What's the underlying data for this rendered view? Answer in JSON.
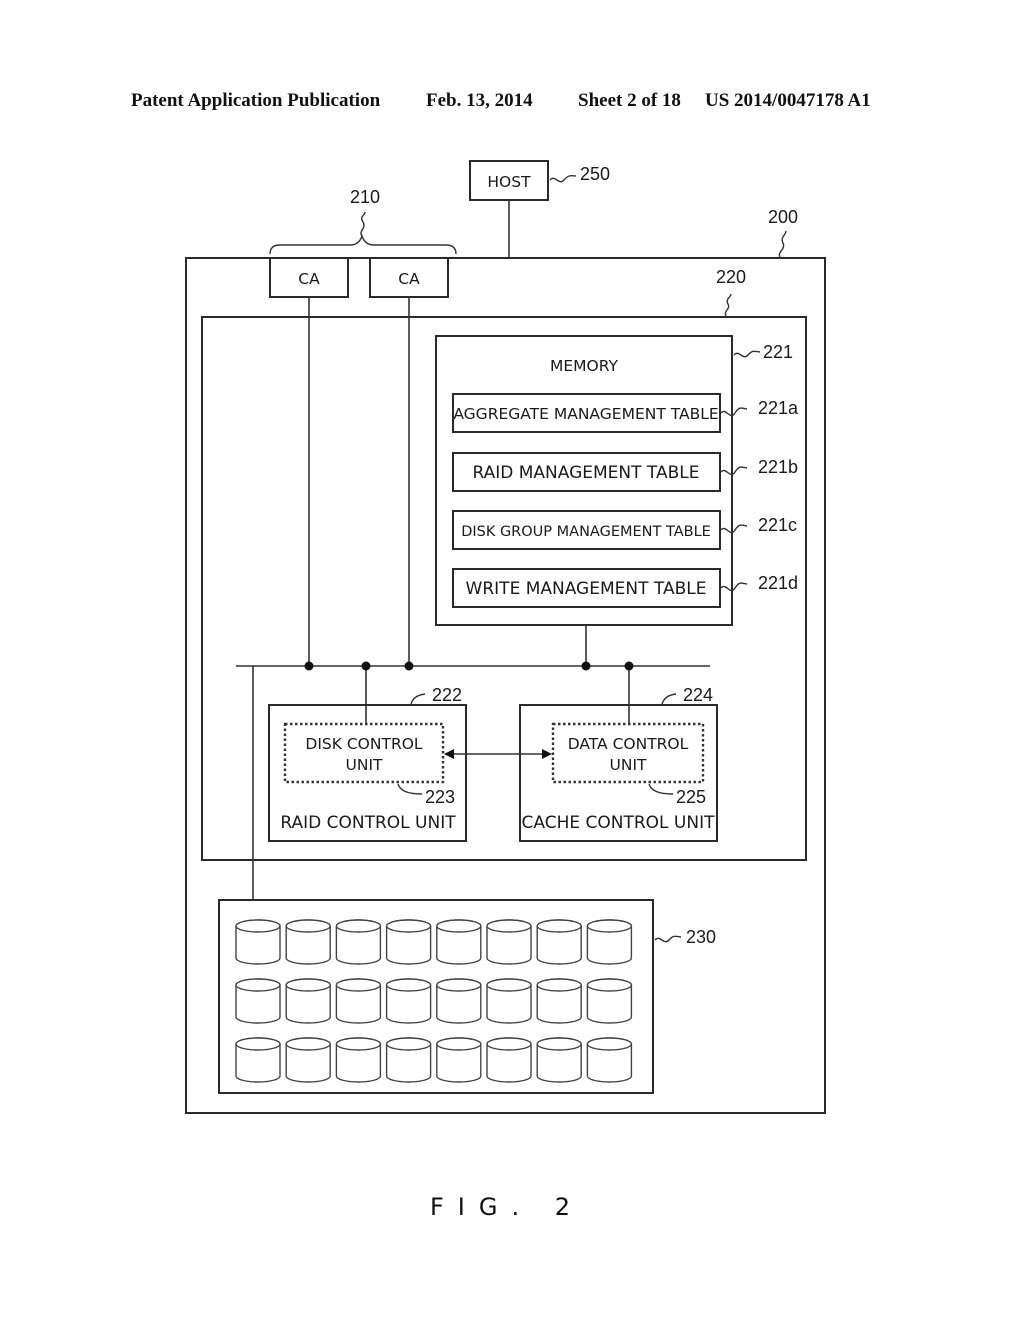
{
  "header": {
    "publication": "Patent Application Publication",
    "date": "Feb. 13, 2014",
    "sheet": "Sheet 2 of 18",
    "number": "US 2014/0047178 A1"
  },
  "diagram": {
    "host": {
      "label": "HOST",
      "ref": "250"
    },
    "storage_apparatus": {
      "ref": "200"
    },
    "channel_adapters": {
      "ref": "210",
      "items": [
        {
          "label": "CA"
        },
        {
          "label": "CA"
        }
      ]
    },
    "controller": {
      "ref": "220"
    },
    "memory": {
      "label": "MEMORY",
      "ref": "221",
      "tables": [
        {
          "label": "AGGREGATE MANAGEMENT TABLE",
          "ref": "221a"
        },
        {
          "label": "RAID MANAGEMENT TABLE",
          "ref": "221b"
        },
        {
          "label": "DISK GROUP MANAGEMENT TABLE",
          "ref": "221c"
        },
        {
          "label": "WRITE MANAGEMENT TABLE",
          "ref": "221d"
        }
      ]
    },
    "raid_control_unit": {
      "label": "RAID CONTROL UNIT",
      "ref": "222",
      "inner": {
        "line1": "DISK CONTROL",
        "line2": "UNIT",
        "ref": "223"
      }
    },
    "cache_control_unit": {
      "label": "CACHE CONTROL UNIT",
      "ref": "224",
      "inner": {
        "line1": "DATA CONTROL",
        "line2": "UNIT",
        "ref": "225"
      }
    },
    "disk_array": {
      "ref": "230",
      "rows": 3,
      "columns": 8
    }
  },
  "figure_caption": "FIG. 2"
}
